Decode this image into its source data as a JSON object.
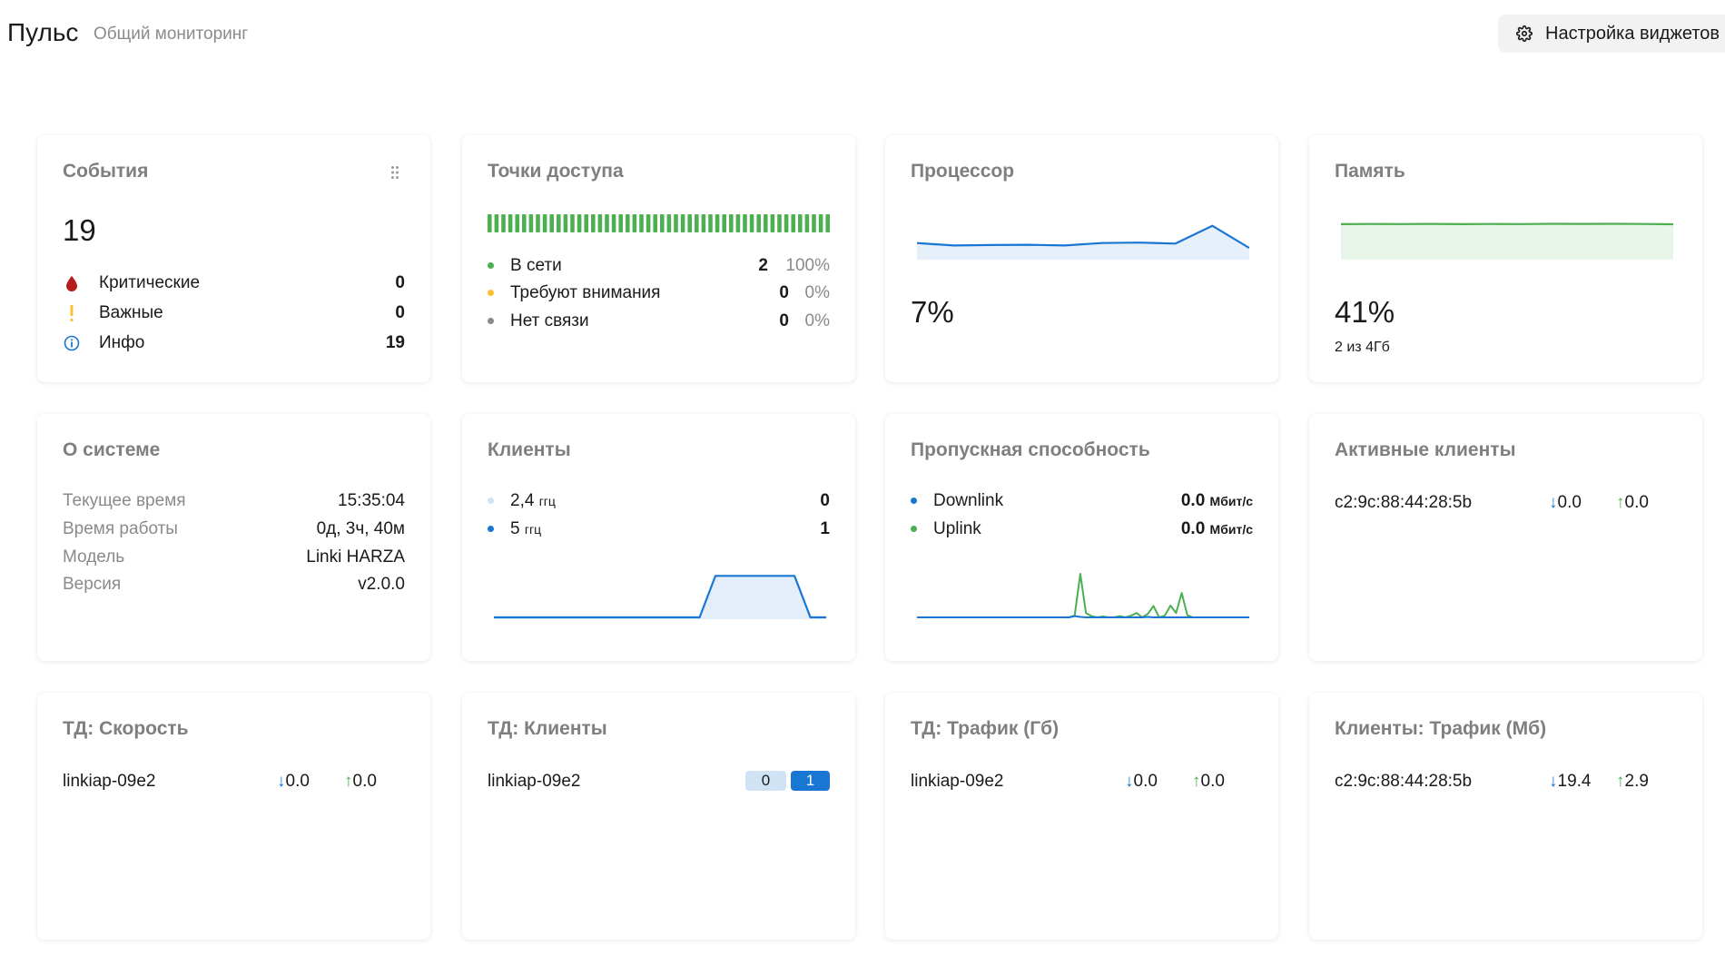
{
  "header": {
    "title": "Пульс",
    "subtitle": "Общий мониторинг",
    "settings_label": "Настройка виджетов"
  },
  "events": {
    "title": "События",
    "total": "19",
    "rows": [
      {
        "label": "Критические",
        "value": "0",
        "icon": "blood-drop-icon",
        "color": "#b71c1c"
      },
      {
        "label": "Важные",
        "value": "0",
        "icon": "exclamation-icon",
        "color": "#fbc02d"
      },
      {
        "label": "Инфо",
        "value": "19",
        "icon": "info-icon",
        "color": "#1976d2"
      }
    ]
  },
  "access_points": {
    "title": "Точки доступа",
    "online_bar_fraction": 1.0,
    "rows": [
      {
        "label": "В сети",
        "count": "2",
        "percent": "100%",
        "color": "#4caf50"
      },
      {
        "label": "Требуют внимания",
        "count": "0",
        "percent": "0%",
        "color": "#fbc02d"
      },
      {
        "label": "Нет связи",
        "count": "0",
        "percent": "0%",
        "color": "#8a8a8a"
      }
    ]
  },
  "cpu": {
    "title": "Процессор",
    "value": "7%",
    "color": "#1976d2",
    "series": [
      6,
      5,
      5.2,
      5.3,
      5,
      6,
      6.2,
      5.8,
      13,
      4
    ]
  },
  "memory": {
    "title": "Память",
    "value": "41%",
    "note": "2 из 4Гб",
    "color": "#4caf50",
    "series": [
      41,
      41.2,
      41.1,
      41.3,
      41,
      41.2,
      41.1,
      41.4,
      41.3,
      41.4,
      41.2,
      40.9
    ]
  },
  "system": {
    "title": "О системе",
    "rows": [
      {
        "label": "Текущее время",
        "value": "15:35:04"
      },
      {
        "label": "Время работы",
        "value": "0д, 3ч, 40м"
      },
      {
        "label": "Модель",
        "value": "Linki HARZA"
      },
      {
        "label": "Версия",
        "value": "v2.0.0"
      }
    ]
  },
  "clients": {
    "title": "Клиенты",
    "rows": [
      {
        "label": "2,4",
        "unit": "ггц",
        "value": "0",
        "color": "#cfe3f5"
      },
      {
        "label": "5",
        "unit": "ггц",
        "value": "1",
        "color": "#1976d2"
      }
    ],
    "series": [
      0,
      0,
      0,
      0,
      0,
      0,
      0,
      0,
      0,
      0,
      0,
      0,
      0,
      0,
      1,
      1,
      1,
      1,
      1,
      1,
      0,
      0
    ]
  },
  "throughput": {
    "title": "Пропускная способность",
    "rows": [
      {
        "label": "Downlink",
        "value": "0.0",
        "unit": "Мбит/с",
        "color": "#1976d2"
      },
      {
        "label": "Uplink",
        "value": "0.0",
        "unit": "Мбит/с",
        "color": "#4caf50"
      }
    ],
    "downlink_series": [
      0,
      0,
      0,
      0,
      0,
      0,
      0,
      0,
      0,
      0,
      0,
      0,
      0,
      0,
      0,
      0,
      0,
      0,
      0,
      0,
      0,
      0,
      0,
      0,
      0,
      0,
      0,
      0,
      0.3,
      0.1,
      0,
      0,
      0,
      0,
      0,
      0,
      0,
      0,
      0,
      0,
      0,
      0.1,
      0,
      0,
      0,
      0,
      0,
      0,
      0,
      0,
      0,
      0,
      0,
      0,
      0,
      0,
      0,
      0,
      0,
      0
    ],
    "uplink_series": [
      0,
      0,
      0,
      0,
      0,
      0,
      0,
      0,
      0,
      0,
      0,
      0,
      0,
      0,
      0,
      0,
      0,
      0,
      0,
      0,
      0,
      0,
      0,
      0,
      0,
      0,
      0,
      0,
      0.4,
      10,
      1,
      0.3,
      0,
      0.2,
      0,
      0,
      0.3,
      0,
      0.4,
      1,
      0,
      0.8,
      2.6,
      0,
      0.4,
      2.7,
      1,
      5.6,
      0.5,
      0,
      0,
      0,
      0,
      0,
      0,
      0,
      0,
      0,
      0,
      0
    ]
  },
  "active_clients": {
    "title": "Активные клиенты",
    "rows": [
      {
        "name": "c2:9c:88:44:28:5b",
        "down": "0.0",
        "up": "0.0"
      }
    ]
  },
  "ap_speed": {
    "title": "ТД: Скорость",
    "rows": [
      {
        "name": "linkiap-09e2",
        "down": "0.0",
        "up": "0.0"
      }
    ]
  },
  "ap_clients": {
    "title": "ТД: Клиенты",
    "rows": [
      {
        "name": "linkiap-09e2",
        "band24": "0",
        "band5": "1"
      }
    ]
  },
  "ap_traffic": {
    "title": "ТД: Трафик (Гб)",
    "rows": [
      {
        "name": "linkiap-09e2",
        "down": "0.0",
        "up": "0.0"
      }
    ]
  },
  "client_traffic": {
    "title": "Клиенты: Трафик (Мб)",
    "rows": [
      {
        "name": "c2:9c:88:44:28:5b",
        "down": "19.4",
        "up": "2.9"
      }
    ]
  },
  "arrows": {
    "down": "↓",
    "up": "↑"
  }
}
